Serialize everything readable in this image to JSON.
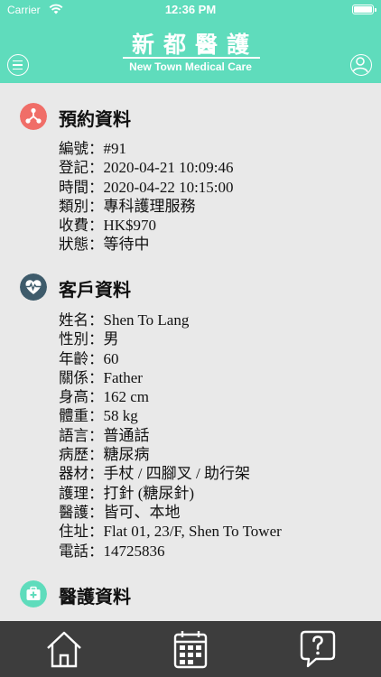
{
  "status": {
    "carrier": "Carrier",
    "time": "12:36 PM"
  },
  "header": {
    "title_cn": "新都醫護",
    "title_en": "New Town Medical Care"
  },
  "appointment": {
    "title": "預約資料",
    "rows": [
      {
        "label": "編號：",
        "value": "#91"
      },
      {
        "label": "登記：",
        "value": "2020-04-21 10:09:46"
      },
      {
        "label": "時間：",
        "value": "2020-04-22 10:15:00"
      },
      {
        "label": "類別：",
        "value": "專科護理服務"
      },
      {
        "label": "收費：",
        "value": "HK$970"
      },
      {
        "label": "狀態：",
        "value": "等待中"
      }
    ]
  },
  "client": {
    "title": "客戶資料",
    "rows": [
      {
        "label": "姓名：",
        "value": "Shen To Lang"
      },
      {
        "label": "性別：",
        "value": "男"
      },
      {
        "label": "年齡：",
        "value": "60"
      },
      {
        "label": "關係：",
        "value": "Father"
      },
      {
        "label": "身高：",
        "value": "162 cm"
      },
      {
        "label": "體重：",
        "value": "58 kg"
      },
      {
        "label": "語言：",
        "value": "普通話"
      },
      {
        "label": "病歷：",
        "value": "糖尿病"
      },
      {
        "label": "器材：",
        "value": "手杖 / 四腳叉 / 助行架"
      },
      {
        "label": "護理：",
        "value": "打針 (糖尿針)"
      },
      {
        "label": "醫護：",
        "value": "皆可、本地"
      },
      {
        "label": "住址：",
        "value": "Flat 01, 23/F, Shen To Tower"
      },
      {
        "label": "電話：",
        "value": "14725836"
      }
    ]
  },
  "medical": {
    "title": "醫護資料"
  },
  "icons": {
    "appointment": "share-nodes-icon",
    "client": "heart-pulse-icon",
    "medical": "medical-kit-icon",
    "tabs": [
      "home-icon",
      "calendar-icon",
      "help-chat-icon"
    ]
  },
  "colors": {
    "header": "#5fdcbc",
    "appointment_icon": "#f06e68",
    "client_icon": "#3e5b6b",
    "medical_icon": "#5fdcbc",
    "tabbar": "#3d3d3d",
    "background": "#e9e9e9"
  }
}
